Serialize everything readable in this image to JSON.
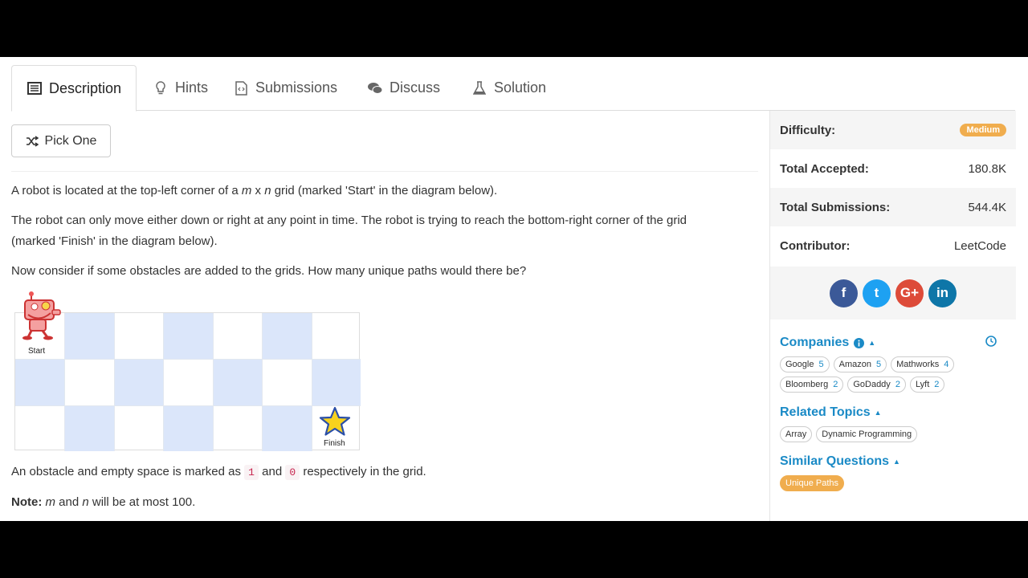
{
  "tabs": [
    {
      "label": "Description",
      "icon": "description-icon",
      "active": true
    },
    {
      "label": "Hints",
      "icon": "lightbulb-icon",
      "active": false
    },
    {
      "label": "Submissions",
      "icon": "code-file-icon",
      "active": false
    },
    {
      "label": "Discuss",
      "icon": "comments-icon",
      "active": false
    },
    {
      "label": "Solution",
      "icon": "flask-icon",
      "active": false
    }
  ],
  "pick_one": {
    "label": "Pick One",
    "icon": "shuffle-icon"
  },
  "description": {
    "p1": {
      "a": "A robot is located at the top-left corner of a ",
      "m": "m",
      "x": " x ",
      "n": "n",
      "b": " grid (marked 'Start' in the diagram below)."
    },
    "p2": "The robot can only move either down or right at any point in time. The robot is trying to reach the bottom-right corner of the grid (marked 'Finish' in the diagram below).",
    "p3": "Now consider if some obstacles are added to the grids. How many unique paths would there be?",
    "p4": {
      "a": "An obstacle and empty space is marked as ",
      "c1": "1",
      "b": " and ",
      "c2": "0",
      "c": " respectively in the grid."
    },
    "note": {
      "label": "Note:",
      "m": "m",
      "mid": " and ",
      "n": "n",
      "end": " will be at most 100."
    }
  },
  "diagram": {
    "start_label": "Start",
    "finish_label": "Finish",
    "rows": 3,
    "cols": 7
  },
  "sidebar": {
    "difficulty_label": "Difficulty:",
    "difficulty_value": "Medium",
    "accepted_label": "Total Accepted:",
    "accepted_value": "180.8K",
    "submissions_label": "Total Submissions:",
    "submissions_value": "544.4K",
    "contributor_label": "Contributor:",
    "contributor_value": "LeetCode",
    "social": [
      {
        "glyph": "f",
        "icon": "facebook-icon"
      },
      {
        "glyph": "t",
        "icon": "twitter-icon"
      },
      {
        "glyph": "G+",
        "icon": "google-plus-icon"
      },
      {
        "glyph": "in",
        "icon": "linkedin-icon"
      }
    ],
    "companies_title": "Companies",
    "companies": [
      {
        "name": "Google",
        "count": "5"
      },
      {
        "name": "Amazon",
        "count": "5"
      },
      {
        "name": "Mathworks",
        "count": "4"
      },
      {
        "name": "Bloomberg",
        "count": "2"
      },
      {
        "name": "GoDaddy",
        "count": "2"
      },
      {
        "name": "Lyft",
        "count": "2"
      }
    ],
    "related_title": "Related Topics",
    "related": [
      "Array",
      "Dynamic Programming"
    ],
    "similar_title": "Similar Questions",
    "similar": [
      "Unique Paths"
    ]
  },
  "colors": {
    "accent": "#1a8ac6",
    "medium": "#f0ad4e",
    "grid_shade": "#dbe6fa"
  }
}
